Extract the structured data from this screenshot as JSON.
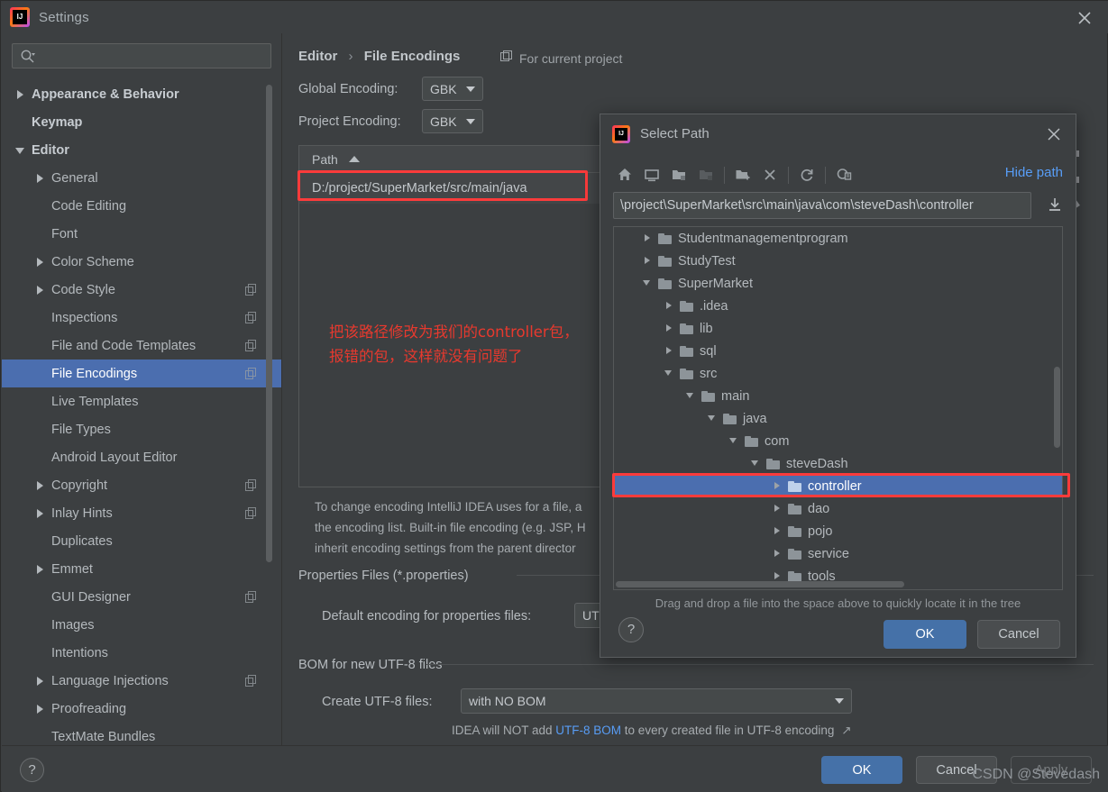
{
  "window": {
    "title": "Settings",
    "app_icon": "intellij-icon",
    "close_icon": "close-icon"
  },
  "sidebar": {
    "search": {
      "placeholder": "",
      "value": "",
      "icon": "search-icon"
    },
    "items": [
      {
        "label": "Appearance & Behavior",
        "arrow": "right",
        "indent": 0,
        "bold": true,
        "badge": false,
        "selected": false
      },
      {
        "label": "Keymap",
        "arrow": "none",
        "indent": 0,
        "bold": true,
        "badge": false,
        "selected": false
      },
      {
        "label": "Editor",
        "arrow": "down",
        "indent": 0,
        "bold": true,
        "badge": false,
        "selected": false
      },
      {
        "label": "General",
        "arrow": "right",
        "indent": 1,
        "bold": false,
        "badge": false,
        "selected": false
      },
      {
        "label": "Code Editing",
        "arrow": "none",
        "indent": 1,
        "bold": false,
        "badge": false,
        "selected": false
      },
      {
        "label": "Font",
        "arrow": "none",
        "indent": 1,
        "bold": false,
        "badge": false,
        "selected": false
      },
      {
        "label": "Color Scheme",
        "arrow": "right",
        "indent": 1,
        "bold": false,
        "badge": false,
        "selected": false
      },
      {
        "label": "Code Style",
        "arrow": "right",
        "indent": 1,
        "bold": false,
        "badge": true,
        "selected": false
      },
      {
        "label": "Inspections",
        "arrow": "none",
        "indent": 1,
        "bold": false,
        "badge": true,
        "selected": false
      },
      {
        "label": "File and Code Templates",
        "arrow": "none",
        "indent": 1,
        "bold": false,
        "badge": true,
        "selected": false
      },
      {
        "label": "File Encodings",
        "arrow": "none",
        "indent": 1,
        "bold": false,
        "badge": true,
        "selected": true
      },
      {
        "label": "Live Templates",
        "arrow": "none",
        "indent": 1,
        "bold": false,
        "badge": false,
        "selected": false
      },
      {
        "label": "File Types",
        "arrow": "none",
        "indent": 1,
        "bold": false,
        "badge": false,
        "selected": false
      },
      {
        "label": "Android Layout Editor",
        "arrow": "none",
        "indent": 1,
        "bold": false,
        "badge": false,
        "selected": false
      },
      {
        "label": "Copyright",
        "arrow": "right",
        "indent": 1,
        "bold": false,
        "badge": true,
        "selected": false
      },
      {
        "label": "Inlay Hints",
        "arrow": "right",
        "indent": 1,
        "bold": false,
        "badge": true,
        "selected": false
      },
      {
        "label": "Duplicates",
        "arrow": "none",
        "indent": 1,
        "bold": false,
        "badge": false,
        "selected": false
      },
      {
        "label": "Emmet",
        "arrow": "right",
        "indent": 1,
        "bold": false,
        "badge": false,
        "selected": false
      },
      {
        "label": "GUI Designer",
        "arrow": "none",
        "indent": 1,
        "bold": false,
        "badge": true,
        "selected": false
      },
      {
        "label": "Images",
        "arrow": "none",
        "indent": 1,
        "bold": false,
        "badge": false,
        "selected": false
      },
      {
        "label": "Intentions",
        "arrow": "none",
        "indent": 1,
        "bold": false,
        "badge": false,
        "selected": false
      },
      {
        "label": "Language Injections",
        "arrow": "right",
        "indent": 1,
        "bold": false,
        "badge": true,
        "selected": false
      },
      {
        "label": "Proofreading",
        "arrow": "right",
        "indent": 1,
        "bold": false,
        "badge": false,
        "selected": false
      },
      {
        "label": "TextMate Bundles",
        "arrow": "none",
        "indent": 1,
        "bold": false,
        "badge": false,
        "selected": false
      }
    ]
  },
  "main": {
    "breadcrumb_parent": "Editor",
    "breadcrumb_separator": "›",
    "breadcrumb_current": "File Encodings",
    "for_current_project": "For current project",
    "global_encoding_label": "Global Encoding:",
    "global_encoding_value": "GBK",
    "project_encoding_label": "Project Encoding:",
    "project_encoding_value": "GBK",
    "table_header_path": "Path",
    "table_rows": [
      {
        "path": "D:/project/SuperMarket/src/main/java"
      }
    ],
    "annotation_line1": "把该路径修改为我们的controller包，",
    "annotation_line2": "报错的包，这样就没有问题了",
    "help_line1": "To change encoding IntelliJ IDEA uses for a file, a",
    "help_line2": "the encoding list. Built-in file encoding (e.g. JSP, H",
    "help_line3": "inherit encoding settings from the parent director",
    "properties_section": "Properties Files (*.properties)",
    "properties_label": "Default encoding for properties files:",
    "properties_value": "UT",
    "bom_section": "BOM for new UTF-8 files",
    "create_utf8_label": "Create UTF-8 files:",
    "create_utf8_value": "with NO BOM",
    "bom_note_prefix": "IDEA will NOT add ",
    "bom_note_link": "UTF-8 BOM",
    "bom_note_suffix": " to every created file in UTF-8 encoding",
    "external_link_icon": "external-link-icon"
  },
  "dialog": {
    "title": "Select Path",
    "app_icon": "intellij-icon",
    "close_icon": "close-icon",
    "toolbar": [
      {
        "name": "home-icon",
        "tooltip": "Home"
      },
      {
        "name": "desktop-icon",
        "tooltip": "Desktop"
      },
      {
        "name": "project-folder-icon",
        "tooltip": "Project"
      },
      {
        "name": "module-folder-icon",
        "tooltip": "Module"
      },
      {
        "name": "new-folder-icon",
        "tooltip": "New Folder"
      },
      {
        "name": "delete-icon",
        "tooltip": "Delete"
      },
      {
        "name": "refresh-icon",
        "tooltip": "Refresh"
      },
      {
        "name": "show-hidden-icon",
        "tooltip": "Show Hidden Files"
      }
    ],
    "hide_path_label": "Hide path",
    "path_value": "\\project\\SuperMarket\\src\\main\\java\\com\\steveDash\\controller",
    "path_download_icon": "download-icon",
    "tree": [
      {
        "label": "Studentmanagementprogram",
        "arrow": "right",
        "indent": 1,
        "selected": false
      },
      {
        "label": "StudyTest",
        "arrow": "right",
        "indent": 1,
        "selected": false
      },
      {
        "label": "SuperMarket",
        "arrow": "down",
        "indent": 1,
        "selected": false
      },
      {
        "label": ".idea",
        "arrow": "right",
        "indent": 2,
        "selected": false
      },
      {
        "label": "lib",
        "arrow": "right",
        "indent": 2,
        "selected": false
      },
      {
        "label": "sql",
        "arrow": "right",
        "indent": 2,
        "selected": false
      },
      {
        "label": "src",
        "arrow": "down",
        "indent": 2,
        "selected": false
      },
      {
        "label": "main",
        "arrow": "down",
        "indent": 3,
        "selected": false
      },
      {
        "label": "java",
        "arrow": "down",
        "indent": 4,
        "selected": false
      },
      {
        "label": "com",
        "arrow": "down",
        "indent": 5,
        "selected": false
      },
      {
        "label": "steveDash",
        "arrow": "down",
        "indent": 6,
        "selected": false
      },
      {
        "label": "controller",
        "arrow": "right",
        "indent": 7,
        "selected": true
      },
      {
        "label": "dao",
        "arrow": "right",
        "indent": 7,
        "selected": false
      },
      {
        "label": "pojo",
        "arrow": "right",
        "indent": 7,
        "selected": false
      },
      {
        "label": "service",
        "arrow": "right",
        "indent": 7,
        "selected": false
      },
      {
        "label": "tools",
        "arrow": "right",
        "indent": 7,
        "selected": false
      }
    ],
    "drag_note": "Drag and drop a file into the space above to quickly locate it in the tree",
    "help_label": "?",
    "ok_label": "OK",
    "cancel_label": "Cancel"
  },
  "footer": {
    "help_label": "?",
    "ok_label": "OK",
    "cancel_label": "Cancel",
    "apply_label": "Apply"
  },
  "watermark": "CSDN @Stevedash",
  "colors": {
    "background": "#3c3f41",
    "selection": "#4b6eaf",
    "primary_button": "#4571a8",
    "link": "#589df6",
    "annotation_red": "#e8392e",
    "highlight_box": "#fc3b3b"
  }
}
